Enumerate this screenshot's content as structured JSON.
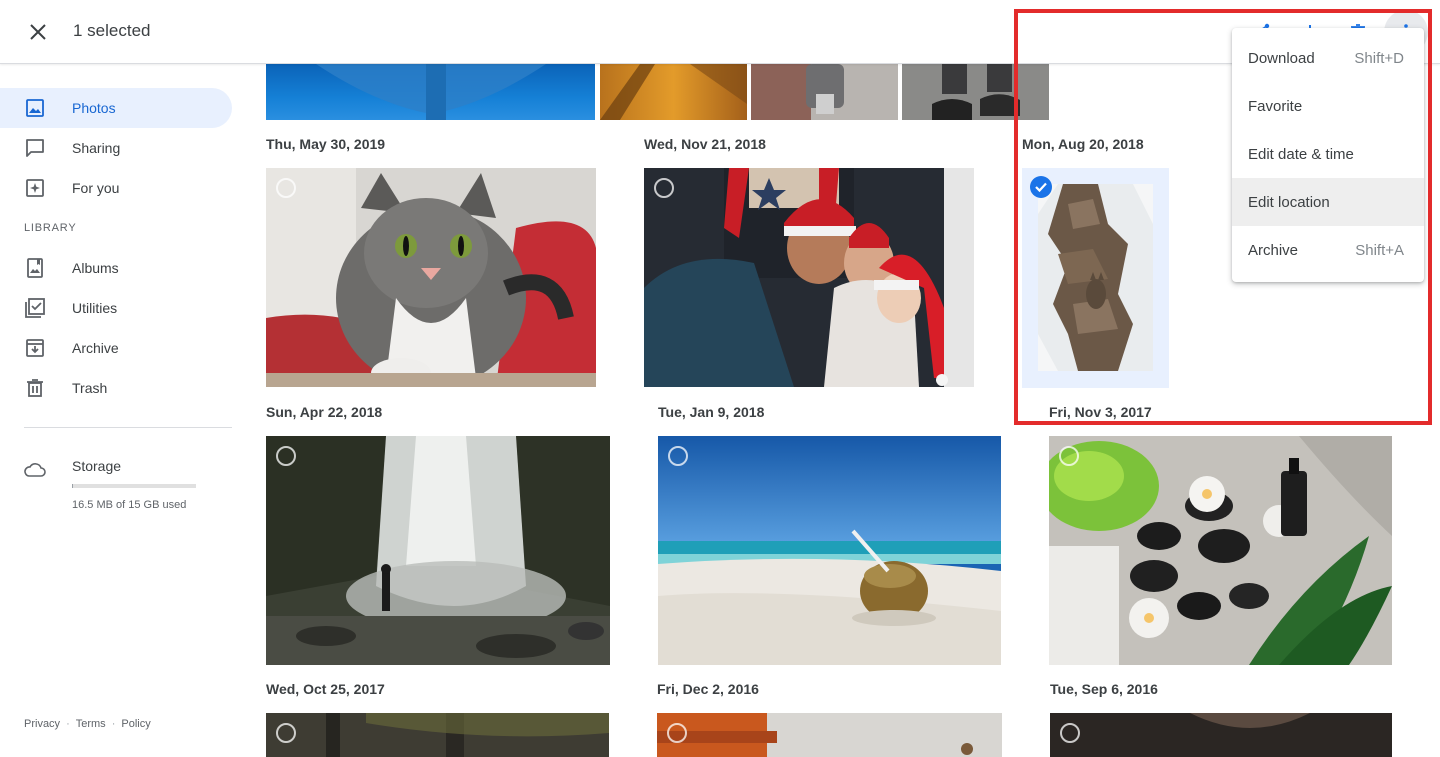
{
  "header": {
    "selected_text": "1 selected"
  },
  "sidebar": {
    "items": [
      {
        "label": "Photos",
        "icon": "photos-icon"
      },
      {
        "label": "Sharing",
        "icon": "sharing-icon"
      },
      {
        "label": "For you",
        "icon": "for-you-icon"
      }
    ],
    "library_header": "LIBRARY",
    "library_items": [
      {
        "label": "Albums",
        "icon": "albums-icon"
      },
      {
        "label": "Utilities",
        "icon": "utilities-icon"
      },
      {
        "label": "Archive",
        "icon": "archive-icon"
      },
      {
        "label": "Trash",
        "icon": "trash-icon"
      }
    ],
    "storage": {
      "label": "Storage",
      "used_text": "16.5 MB of 15 GB used",
      "used_fraction": 0.001
    }
  },
  "dates": {
    "d1": "Thu, May 30, 2019",
    "d2": "Wed, Nov 21, 2018",
    "d3": "Mon, Aug 20, 2018",
    "d4": "Sun, Apr 22, 2018",
    "d5": "Tue, Jan 9, 2018",
    "d6": "Fri, Nov 3, 2017",
    "d7": "Wed, Oct 25, 2017",
    "d8": "Fri, Dec 2, 2016",
    "d9": "Tue, Sep 6, 2016"
  },
  "menu": {
    "items": [
      {
        "label": "Download",
        "shortcut": "Shift+D"
      },
      {
        "label": "Favorite",
        "shortcut": ""
      },
      {
        "label": "Edit date & time",
        "shortcut": ""
      },
      {
        "label": "Edit location",
        "shortcut": ""
      },
      {
        "label": "Archive",
        "shortcut": "Shift+A"
      }
    ]
  },
  "footer": {
    "privacy": "Privacy",
    "terms": "Terms",
    "policy": "Policy"
  },
  "colors": {
    "accent": "#1a73e8",
    "highlight_box": "#e32b2b",
    "active_nav_bg": "#e8f0fe"
  }
}
